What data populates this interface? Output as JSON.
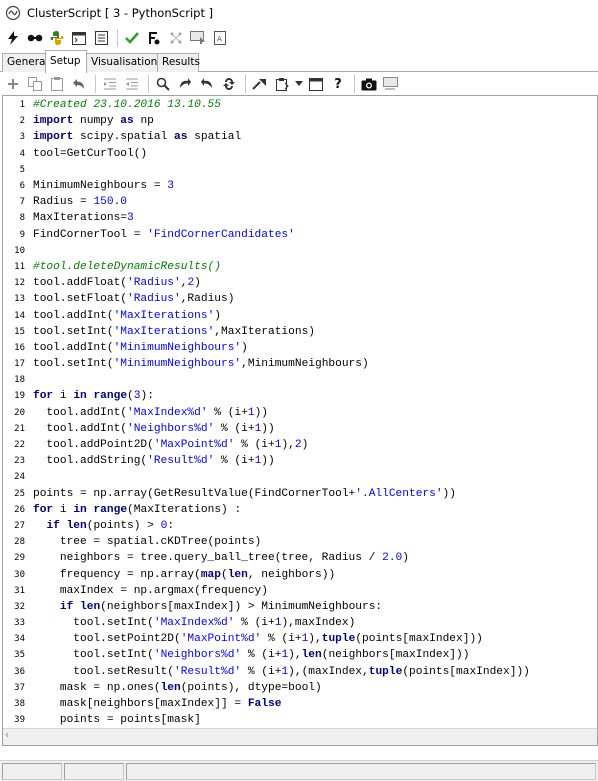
{
  "window": {
    "title": "ClusterScript [ 3 - PythonScript ]"
  },
  "toolbar1": {
    "icons": [
      "lightning-icon",
      "glasses-icon",
      "python-icon",
      "console-icon",
      "document-icon",
      "checkmark-icon",
      "compile-icon",
      "tree-icon",
      "monitor-icon",
      "page-icon"
    ]
  },
  "tabs": [
    {
      "label": "General",
      "active": false
    },
    {
      "label": "Setup",
      "active": true
    },
    {
      "label": "Visualisation",
      "active": false
    },
    {
      "label": "Results",
      "active": false
    }
  ],
  "toolbar2": {
    "icons": [
      "add-icon",
      "copy-icon",
      "paste-icon",
      "undo-icon",
      "indent-icon",
      "outdent-icon",
      "search-icon",
      "redo-icon",
      "redo2-icon",
      "replace-icon",
      "bookmark-icon",
      "clipboard-icon",
      "window-icon",
      "help-icon",
      "camera-icon",
      "monitor-icon"
    ]
  },
  "editor": {
    "lines": [
      {
        "n": "1",
        "t": [
          [
            "cmt",
            "#Created 23.10.2016 13.10.55"
          ]
        ]
      },
      {
        "n": "2",
        "t": [
          [
            "kw",
            "import"
          ],
          [
            "",
            " numpy "
          ],
          [
            "kw",
            "as"
          ],
          [
            "",
            " np"
          ]
        ]
      },
      {
        "n": "3",
        "t": [
          [
            "kw",
            "import"
          ],
          [
            "",
            " scipy.spatial "
          ],
          [
            "kw",
            "as"
          ],
          [
            "",
            " spatial"
          ]
        ]
      },
      {
        "n": "4",
        "t": [
          [
            "",
            "tool=GetCurTool()"
          ]
        ]
      },
      {
        "n": "5",
        "t": []
      },
      {
        "n": "6",
        "t": [
          [
            "",
            "MinimumNeighbours = "
          ],
          [
            "num",
            "3"
          ]
        ]
      },
      {
        "n": "7",
        "t": [
          [
            "",
            "Radius = "
          ],
          [
            "num",
            "150.0"
          ]
        ]
      },
      {
        "n": "8",
        "t": [
          [
            "",
            "MaxIterations="
          ],
          [
            "num",
            "3"
          ]
        ]
      },
      {
        "n": "9",
        "t": [
          [
            "",
            "FindCornerTool = "
          ],
          [
            "str",
            "'FindCornerCandidates'"
          ]
        ]
      },
      {
        "n": "10",
        "t": []
      },
      {
        "n": "11",
        "t": [
          [
            "cmt",
            "#tool.deleteDynamicResults()"
          ]
        ]
      },
      {
        "n": "12",
        "t": [
          [
            "",
            "tool.addFloat("
          ],
          [
            "str",
            "'Radius'"
          ],
          [
            "",
            ","
          ],
          [
            "num",
            "2"
          ],
          [
            "",
            ")"
          ]
        ]
      },
      {
        "n": "13",
        "t": [
          [
            "",
            "tool.setFloat("
          ],
          [
            "str",
            "'Radius'"
          ],
          [
            "",
            ",Radius)"
          ]
        ]
      },
      {
        "n": "14",
        "t": [
          [
            "",
            "tool.addInt("
          ],
          [
            "str",
            "'MaxIterations'"
          ],
          [
            "",
            ")"
          ]
        ]
      },
      {
        "n": "15",
        "t": [
          [
            "",
            "tool.setInt("
          ],
          [
            "str",
            "'MaxIterations'"
          ],
          [
            "",
            ",MaxIterations)"
          ]
        ]
      },
      {
        "n": "16",
        "t": [
          [
            "",
            "tool.addInt("
          ],
          [
            "str",
            "'MinimumNeighbours'"
          ],
          [
            "",
            ")"
          ]
        ]
      },
      {
        "n": "17",
        "t": [
          [
            "",
            "tool.setInt("
          ],
          [
            "str",
            "'MinimumNeighbours'"
          ],
          [
            "",
            ",MinimumNeighbours)"
          ]
        ]
      },
      {
        "n": "18",
        "t": []
      },
      {
        "n": "19",
        "t": [
          [
            "kw",
            "for"
          ],
          [
            "",
            " i "
          ],
          [
            "kw",
            "in"
          ],
          [
            "",
            " "
          ],
          [
            "kw",
            "range"
          ],
          [
            "",
            "("
          ],
          [
            "num",
            "3"
          ],
          [
            "",
            "):"
          ]
        ]
      },
      {
        "n": "20",
        "t": [
          [
            "",
            "  tool.addInt("
          ],
          [
            "str",
            "'MaxIndex%d'"
          ],
          [
            "",
            " % (i+"
          ],
          [
            "num",
            "1"
          ],
          [
            "",
            "))"
          ]
        ]
      },
      {
        "n": "21",
        "t": [
          [
            "",
            "  tool.addInt("
          ],
          [
            "str",
            "'Neighbors%d'"
          ],
          [
            "",
            " % (i+"
          ],
          [
            "num",
            "1"
          ],
          [
            "",
            "))"
          ]
        ]
      },
      {
        "n": "22",
        "t": [
          [
            "",
            "  tool.addPoint2D("
          ],
          [
            "str",
            "'MaxPoint%d'"
          ],
          [
            "",
            " % (i+"
          ],
          [
            "num",
            "1"
          ],
          [
            "",
            "),"
          ],
          [
            "num",
            "2"
          ],
          [
            "",
            ")"
          ]
        ]
      },
      {
        "n": "23",
        "t": [
          [
            "",
            "  tool.addString("
          ],
          [
            "str",
            "'Result%d'"
          ],
          [
            "",
            " % (i+"
          ],
          [
            "num",
            "1"
          ],
          [
            "",
            "))"
          ]
        ]
      },
      {
        "n": "24",
        "t": []
      },
      {
        "n": "25",
        "t": [
          [
            "",
            "points = np.array(GetResultValue(FindCornerTool+"
          ],
          [
            "str",
            "'.AllCenters'"
          ],
          [
            "",
            "))"
          ]
        ]
      },
      {
        "n": "26",
        "t": [
          [
            "kw",
            "for"
          ],
          [
            "",
            " i "
          ],
          [
            "kw",
            "in"
          ],
          [
            "",
            " "
          ],
          [
            "kw",
            "range"
          ],
          [
            "",
            "(MaxIterations) :"
          ]
        ]
      },
      {
        "n": "27",
        "t": [
          [
            "",
            "  "
          ],
          [
            "kw",
            "if"
          ],
          [
            "",
            " "
          ],
          [
            "kw",
            "len"
          ],
          [
            "",
            "(points) > "
          ],
          [
            "num",
            "0"
          ],
          [
            "",
            ":"
          ]
        ]
      },
      {
        "n": "28",
        "t": [
          [
            "",
            "    tree = spatial.cKDTree(points)"
          ]
        ]
      },
      {
        "n": "29",
        "t": [
          [
            "",
            "    neighbors = tree.query_ball_tree(tree, Radius / "
          ],
          [
            "num",
            "2.0"
          ],
          [
            "",
            ")"
          ]
        ]
      },
      {
        "n": "30",
        "t": [
          [
            "",
            "    frequency = np.array("
          ],
          [
            "kw",
            "map"
          ],
          [
            "",
            "("
          ],
          [
            "kw",
            "len"
          ],
          [
            "",
            ", neighbors))"
          ]
        ]
      },
      {
        "n": "31",
        "t": [
          [
            "",
            "    maxIndex = np.argmax(frequency)"
          ]
        ]
      },
      {
        "n": "32",
        "t": [
          [
            "",
            "    "
          ],
          [
            "kw",
            "if"
          ],
          [
            "",
            " "
          ],
          [
            "kw",
            "len"
          ],
          [
            "",
            "(neighbors[maxIndex]) > MinimumNeighbours:"
          ]
        ]
      },
      {
        "n": "33",
        "t": [
          [
            "",
            "      tool.setInt("
          ],
          [
            "str",
            "'MaxIndex%d'"
          ],
          [
            "",
            " % (i+"
          ],
          [
            "num",
            "1"
          ],
          [
            "",
            "),maxIndex)"
          ]
        ]
      },
      {
        "n": "34",
        "t": [
          [
            "",
            "      tool.setPoint2D("
          ],
          [
            "str",
            "'MaxPoint%d'"
          ],
          [
            "",
            " % (i+"
          ],
          [
            "num",
            "1"
          ],
          [
            "",
            "),"
          ],
          [
            "kw",
            "tuple"
          ],
          [
            "",
            "(points[maxIndex]))"
          ]
        ]
      },
      {
        "n": "35",
        "t": [
          [
            "",
            "      tool.setInt("
          ],
          [
            "str",
            "'Neighbors%d'"
          ],
          [
            "",
            " % (i+"
          ],
          [
            "num",
            "1"
          ],
          [
            "",
            "),"
          ],
          [
            "kw",
            "len"
          ],
          [
            "",
            "(neighbors[maxIndex]))"
          ]
        ]
      },
      {
        "n": "36",
        "t": [
          [
            "",
            "      tool.setResult("
          ],
          [
            "str",
            "'Result%d'"
          ],
          [
            "",
            " % (i+"
          ],
          [
            "num",
            "1"
          ],
          [
            "",
            "),(maxIndex,"
          ],
          [
            "kw",
            "tuple"
          ],
          [
            "",
            "(points[maxIndex]))"
          ]
        ]
      },
      {
        "n": "37",
        "t": [
          [
            "",
            "    mask = np.ones("
          ],
          [
            "kw",
            "len"
          ],
          [
            "",
            "(points), dtype=bool)"
          ]
        ]
      },
      {
        "n": "38",
        "t": [
          [
            "",
            "    mask[neighbors[maxIndex]] = "
          ],
          [
            "kw",
            "False"
          ]
        ]
      },
      {
        "n": "39",
        "t": [
          [
            "",
            "    points = points[mask]"
          ]
        ]
      }
    ]
  },
  "colors": {
    "keyword": "#000080",
    "string": "#0000ff",
    "number": "#0000ff",
    "comment": "#008000"
  }
}
